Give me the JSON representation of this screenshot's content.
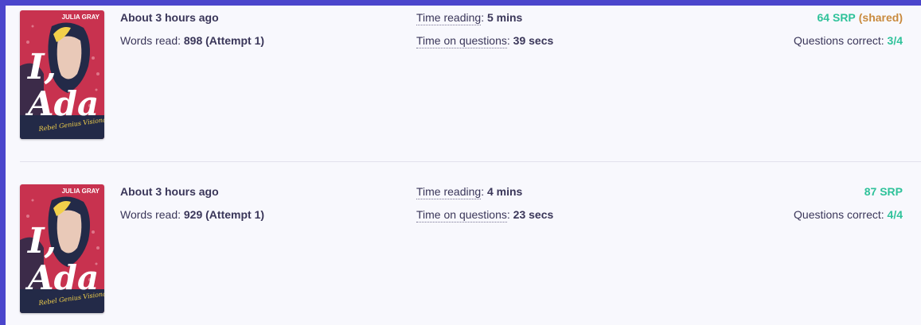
{
  "entries": [
    {
      "book": {
        "author": "JULIA GRAY",
        "title_line1": "I,",
        "title_line2": "Ada",
        "subtitle": "Rebel Genius Visionary"
      },
      "when": "About 3 hours ago",
      "words_label": "Words read: ",
      "words_value": "898 (Attempt 1)",
      "time_reading_label": "Time reading",
      "time_reading_sep": ": ",
      "time_reading_value": "5 mins",
      "time_questions_label": "Time on questions",
      "time_questions_sep": ": ",
      "time_questions_value": "39 secs",
      "srp_value": "64 SRP",
      "srp_note": "(shared)",
      "questions_label": "Questions correct: ",
      "questions_value": "3/4"
    },
    {
      "book": {
        "author": "JULIA GRAY",
        "title_line1": "I,",
        "title_line2": "Ada",
        "subtitle": "Rebel Genius Visionary"
      },
      "when": "About 3 hours ago",
      "words_label": "Words read: ",
      "words_value": "929 (Attempt 1)",
      "time_reading_label": "Time reading",
      "time_reading_sep": ": ",
      "time_reading_value": "4 mins",
      "time_questions_label": "Time on questions",
      "time_questions_sep": ": ",
      "time_questions_value": "23 secs",
      "srp_value": "87 SRP",
      "srp_note": "",
      "questions_label": "Questions correct: ",
      "questions_value": "4/4"
    }
  ],
  "colors": {
    "frame": "#4b46cc",
    "panel": "#f8f8fd",
    "text": "#3a3659",
    "accent_green": "#2fc29a",
    "accent_orange": "#c98a3e",
    "cover_red": "#c8324f",
    "cover_navy": "#232a48",
    "cover_yellow": "#f2d04a"
  }
}
